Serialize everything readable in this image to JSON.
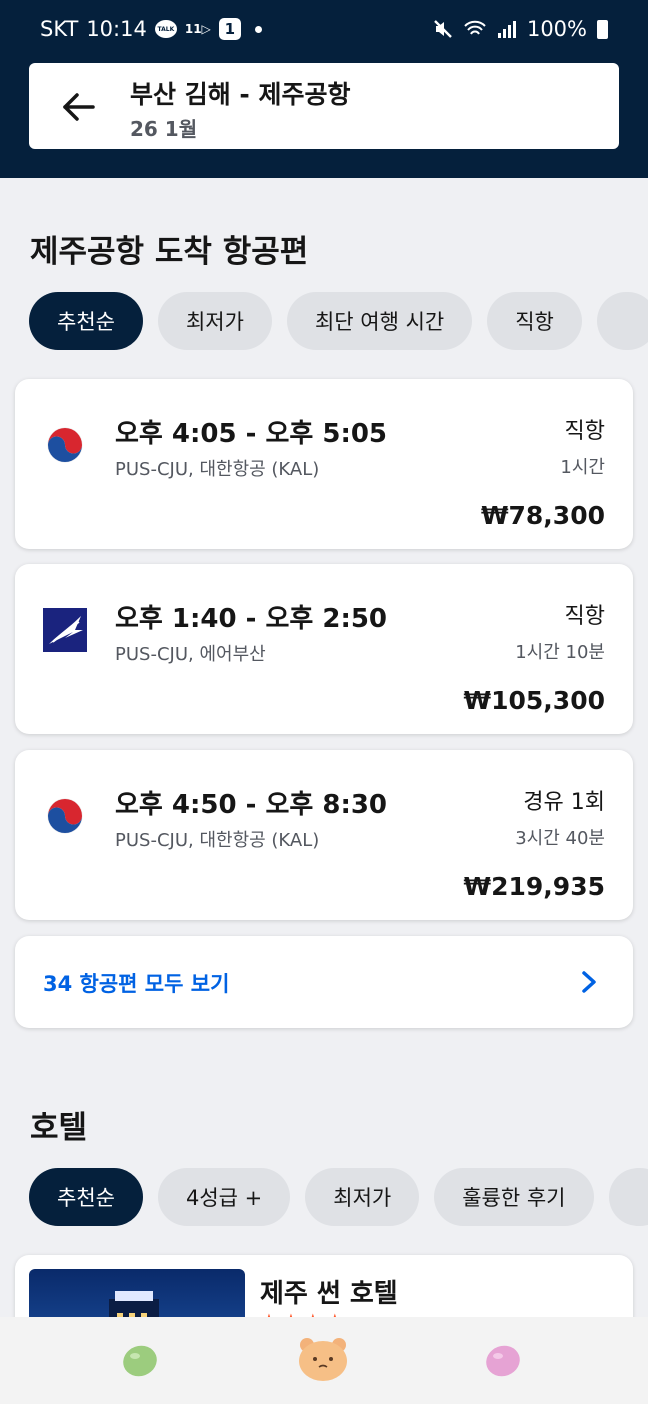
{
  "status_bar": {
    "carrier": "SKT",
    "time": "10:14",
    "talk_icon_text": "TALK",
    "eleven_text": "11▷",
    "badge": "1",
    "battery": "100%"
  },
  "header": {
    "route": "부산 김해 - 제주공항",
    "date": "26 1월"
  },
  "flights_section": {
    "title": "제주공항 도착 항공편",
    "filters": [
      "추천순",
      "최저가",
      "최단 여행 시간",
      "직항"
    ],
    "results": [
      {
        "times": "오후 4:05 - 오후 5:05",
        "carrier": "PUS-CJU, 대한항공 (KAL)",
        "stops": "직항",
        "duration": "1시간",
        "price": "₩78,300",
        "logo": "korean-air-logo"
      },
      {
        "times": "오후 1:40 - 오후 2:50",
        "carrier": "PUS-CJU, 에어부산",
        "stops": "직항",
        "duration": "1시간 10분",
        "price": "₩105,300",
        "logo": "air-busan-logo"
      },
      {
        "times": "오후 4:50 - 오후 8:30",
        "carrier": "PUS-CJU, 대한항공 (KAL)",
        "stops": "경유 1회",
        "duration": "3시간 40분",
        "price": "₩219,935",
        "logo": "korean-air-logo"
      }
    ],
    "see_all": "34 항공편 모두 보기"
  },
  "hotels_section": {
    "title": "호텔",
    "filters": [
      "추천순",
      "4성급 +",
      "최저가",
      "훌륭한 후기"
    ],
    "first_hotel": {
      "name": "제주 썬 호텔",
      "rating": 4
    }
  },
  "colors": {
    "navy": "#05203c",
    "link_blue": "#0062e3",
    "star": "#ff5a2e"
  }
}
